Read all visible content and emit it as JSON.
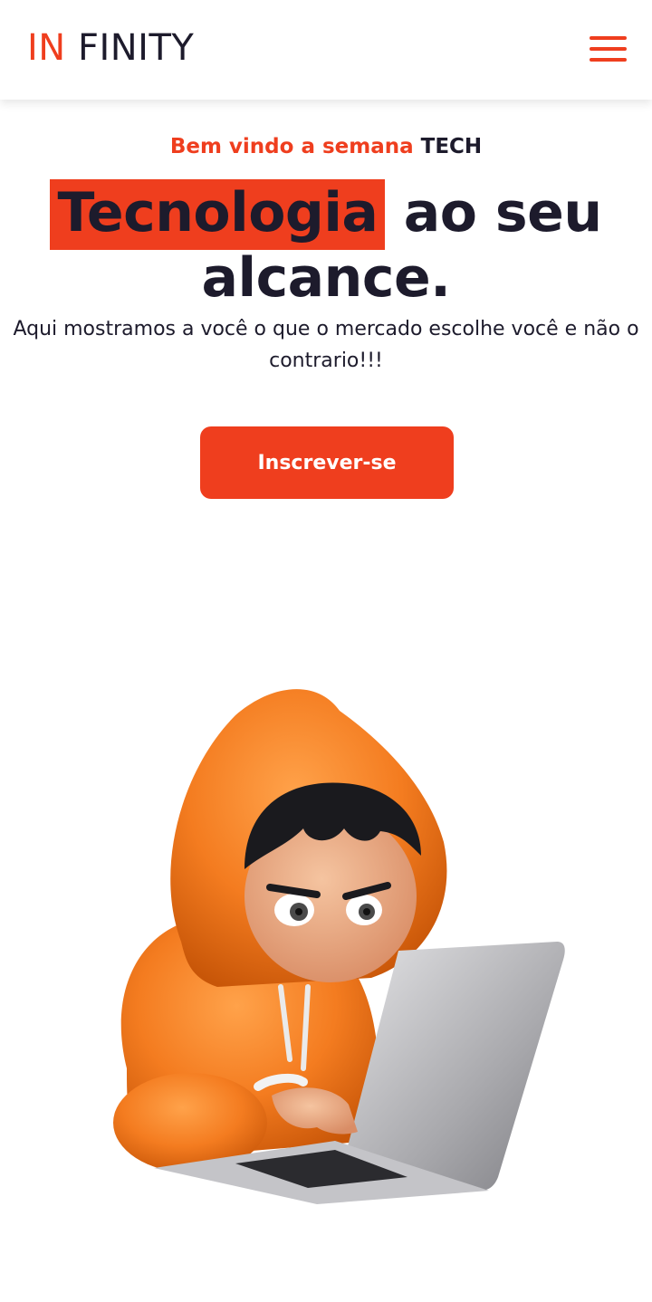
{
  "header": {
    "logo_prefix": "IN",
    "logo_suffix": "FINITY",
    "menu_icon": "hamburger-menu-icon"
  },
  "hero": {
    "eyebrow_prefix": "Bem vindo a semana",
    "eyebrow_suffix": "TECH",
    "headline_highlight": "Tecnologia",
    "headline_rest_line1": " ao seu",
    "headline_line2": "alcance.",
    "subtitle": "Aqui mostramos a você o que o mercado escolhe você e não o contrario!!!",
    "cta_label": "Inscrever-se"
  },
  "illustration": {
    "icon": "hooded-kid-with-laptop-illustration"
  },
  "colors": {
    "accent": "#ef3e1e",
    "dark": "#1d1b2c",
    "hoodie": "#f47c20",
    "laptop": "#b8b8bc"
  }
}
